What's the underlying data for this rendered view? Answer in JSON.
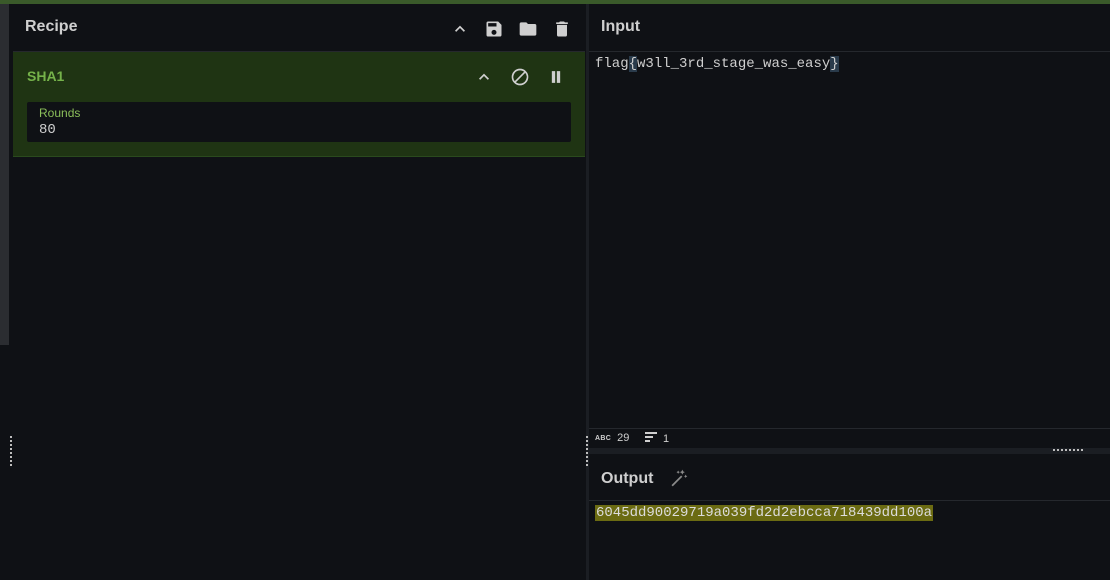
{
  "recipe": {
    "title": "Recipe",
    "actions": [
      {
        "name": "collapse-all",
        "icon": "chevron-up-icon"
      },
      {
        "name": "save",
        "icon": "save-icon"
      },
      {
        "name": "load",
        "icon": "folder-icon"
      },
      {
        "name": "clear",
        "icon": "trash-icon"
      }
    ],
    "operation": {
      "name": "SHA1",
      "controls": [
        {
          "icon": "chevron-up-icon"
        },
        {
          "icon": "disable-icon"
        },
        {
          "icon": "pause-icon"
        }
      ],
      "arg": {
        "label": "Rounds",
        "value": "80"
      }
    }
  },
  "input": {
    "title": "Input",
    "text_prefix": "flag",
    "text_open_brace": "{",
    "text_body": "w3ll_3rd_stage_was_easy",
    "text_close_brace": "}",
    "status": {
      "abc_label": "ABC",
      "chars": "29",
      "lines": "1"
    }
  },
  "output": {
    "title": "Output",
    "magic_icon": "magic-wand-icon",
    "text": "6045dd90029719a039fd2d2ebcca718439dd100a"
  },
  "colors": {
    "op_bg": "#1f3413",
    "op_title": "#75b24a",
    "output_highlight": "#6b6b12",
    "background": "#0f1115"
  }
}
